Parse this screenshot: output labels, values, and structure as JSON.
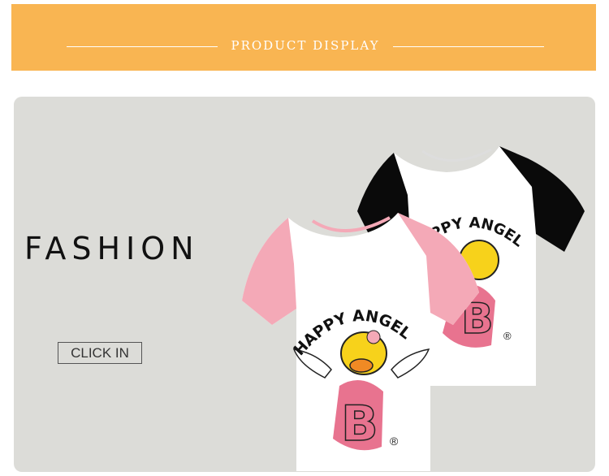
{
  "banner": {
    "title": "PRODUCT DISPLAY",
    "color": "#f9b552"
  },
  "hero": {
    "headline": "FASHION",
    "cta_label": "CLICK IN",
    "background": "#dcdcd8"
  },
  "products": [
    {
      "name": "back-shirt",
      "sleeve_color": "#000000",
      "print_text": "HAPPY ANGEL",
      "letter": "B",
      "mark": "®"
    },
    {
      "name": "front-shirt",
      "sleeve_color": "#f4a9b7",
      "print_text": "HAPPY ANGEL",
      "letter": "B",
      "mark": "®"
    }
  ]
}
